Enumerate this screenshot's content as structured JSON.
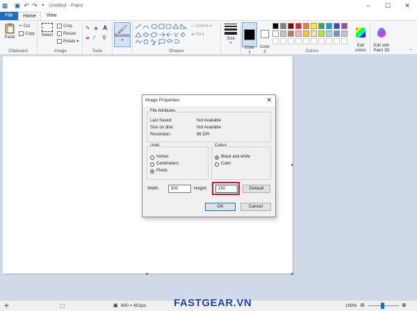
{
  "window": {
    "title": "Untitled - Paint",
    "quick_access": {
      "save_icon": "save-icon",
      "undo_icon": "undo-icon",
      "redo_icon": "redo-icon",
      "customize_icon": "customize-arrow-icon"
    },
    "controls": {
      "minimize": "–",
      "maximize": "☐",
      "close": "✕"
    }
  },
  "tabs": [
    {
      "label": "File"
    },
    {
      "label": "Home"
    },
    {
      "label": "View"
    }
  ],
  "ribbon": {
    "clipboard": {
      "paste": "Paste",
      "cut": "Cut",
      "copy": "Copy",
      "label": "Clipboard"
    },
    "image": {
      "select": "Select",
      "crop": "Crop",
      "resize": "Resize",
      "rotate": "Rotate ▾",
      "label": "Image"
    },
    "tools": {
      "label": "Tools",
      "text_icon": "A"
    },
    "brushes": {
      "label": "Brushes"
    },
    "shapes": {
      "outline": "Outline ▾",
      "fill": "Fill ▾",
      "label": "Shapes"
    },
    "size": {
      "label": "Size"
    },
    "color1": {
      "label": "Color\n1"
    },
    "color2": {
      "label": "Color\n2"
    },
    "colors": {
      "label": "Colors",
      "edit": "Edit\ncolors"
    },
    "paint3d": {
      "label": "Edit with\nPaint 3D"
    },
    "palette": [
      "#000000",
      "#7f7f7f",
      "#880015",
      "#ed1c24",
      "#ff7f27",
      "#fff200",
      "#22b14c",
      "#00a2e8",
      "#3f48cc",
      "#a349a4",
      "#ffffff",
      "#c3c3c3",
      "#b97a57",
      "#ffaec9",
      "#ffc90e",
      "#efe4b0",
      "#b5e61d",
      "#99d9ea",
      "#7092be",
      "#c8bfe7"
    ]
  },
  "dialog": {
    "title": "Image Properties",
    "close": "✕",
    "file_attributes": {
      "legend": "File Attributes",
      "rows": [
        {
          "label": "Last Saved:",
          "value": "Not Available"
        },
        {
          "label": "Size on disk:",
          "value": "Not Available"
        },
        {
          "label": "Resolution:",
          "value": "96 DPI"
        }
      ]
    },
    "units": {
      "legend": "Units",
      "options": [
        "Inches",
        "Centimeters",
        "Pixels"
      ],
      "selected": "Pixels"
    },
    "colors": {
      "legend": "Colors",
      "options": [
        "Black and white",
        "Color"
      ],
      "selected": "Black and white"
    },
    "width_label": "Width:",
    "width_value": "500",
    "height_label": "Height:",
    "height_value": "150",
    "default_button": "Default",
    "ok_button": "OK",
    "cancel_button": "Cancel"
  },
  "statusbar": {
    "dimensions": "800 × 601px",
    "zoom": "100%",
    "zoom_level": 1.0
  },
  "watermark": "FASTGEAR.VN"
}
